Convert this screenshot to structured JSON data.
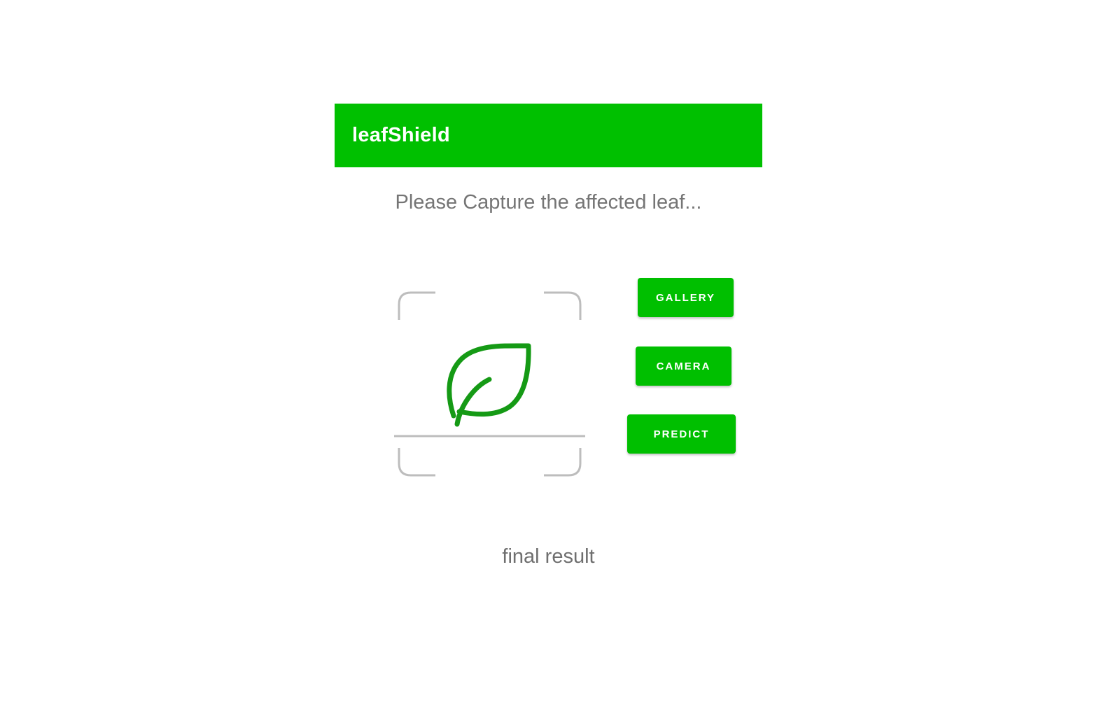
{
  "app_bar": {
    "title": "leafShield",
    "color": "#00c000"
  },
  "prompt": "Please Capture the affected leaf...",
  "preview": {
    "icon": "leaf-scan-icon",
    "leaf_color": "#159a15",
    "frame_color": "#bdbdbd"
  },
  "buttons": {
    "gallery": "GALLERY",
    "camera": "CAMERA",
    "predict": "PREDICT",
    "color": "#00bf00"
  },
  "result": "final result"
}
